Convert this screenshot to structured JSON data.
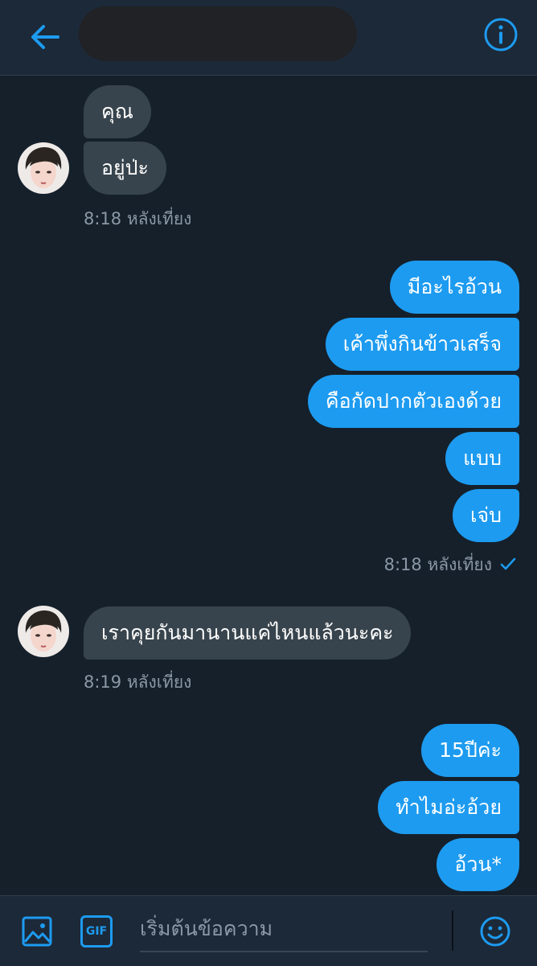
{
  "header": {
    "back_icon": "arrow-left-icon",
    "info_icon": "info-icon",
    "accent": "#1d9bf0"
  },
  "messages": {
    "m1": "คุณ",
    "m2": "อยู่ป่ะ",
    "ts1": "8:18 หลังเที่ยง",
    "m3": "มีอะไรอ้วน",
    "m4": "เค้าพึ่งกินข้าวเสร็จ",
    "m5": "คือกัดปากตัวเองด้วย",
    "m6": "แบบ",
    "m7": "เจ่บ",
    "ts2": "8:18 หลังเที่ยง",
    "m8": "เราคุยกันมานานแค่ไหนแล้วนะคะ",
    "ts3": "8:19 หลังเที่ยง",
    "m9": "15ปีค่ะ",
    "m10": "ทำไมอ่ะอ้วย",
    "m11": "อ้วน*"
  },
  "composer": {
    "placeholder": "เริ่มต้นข้อความ",
    "gif_label": "GIF",
    "image_icon": "image-icon",
    "emoji_icon": "emoji-icon"
  },
  "colors": {
    "background": "#15202b",
    "bar": "#1c2938",
    "incoming_bubble": "#38444d",
    "outgoing_bubble": "#1d9bf0",
    "timestamp": "#8b98a5"
  }
}
